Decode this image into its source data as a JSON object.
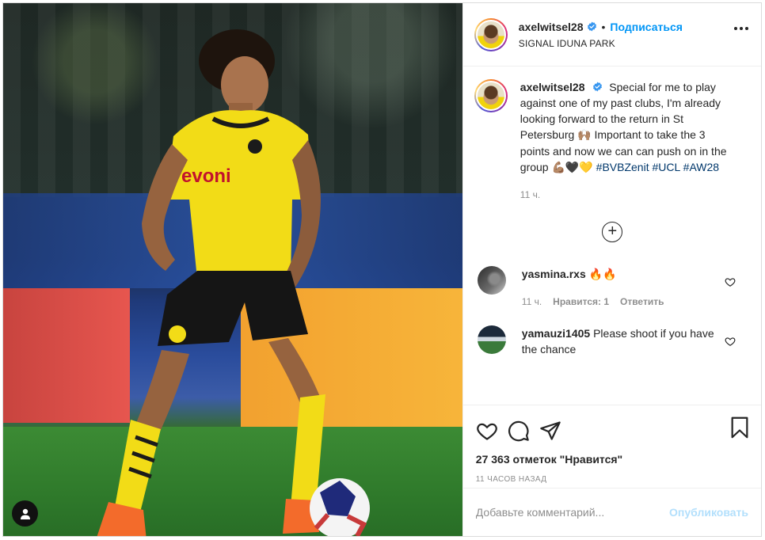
{
  "post": {
    "author": {
      "username": "axelwitsel28",
      "verified": true,
      "follow_label": "Подписаться",
      "separator": "•",
      "location": "SIGNAL IDUNA PARK"
    },
    "caption": {
      "username": "axelwitsel28",
      "text_part1": "Special for me to play against one of my past clubs, I'm already looking forward to the return in St Petersburg",
      "emoji1": "🙌🏽",
      "text_part2": "Important to take the 3 points and now we can can push on in the group",
      "emoji2": "💪🏽🖤💛",
      "hashtags": [
        "#BVBZenit",
        "#UCL",
        "#AW28"
      ],
      "time": "11 ч."
    },
    "load_more_icon": "plus-circle-icon",
    "comments": [
      {
        "username": "yasmina.rxs",
        "text": "🔥🔥",
        "time": "11 ч.",
        "likes_label": "Нравится: 1",
        "reply_label": "Ответить"
      },
      {
        "username": "yamauzi1405",
        "text": "Please shoot if you have the chance"
      }
    ],
    "likes_text": "27 363 отметок \"Нравится\"",
    "posted_ago": "11 часов назад",
    "comment_box": {
      "placeholder": "Добавьте комментарий...",
      "publish_label": "Опубликовать"
    },
    "colors": {
      "accent": "#0095f6",
      "publish_disabled": "#b2dffc",
      "hashtag": "#00376b",
      "muted": "#8e8e8e"
    }
  }
}
